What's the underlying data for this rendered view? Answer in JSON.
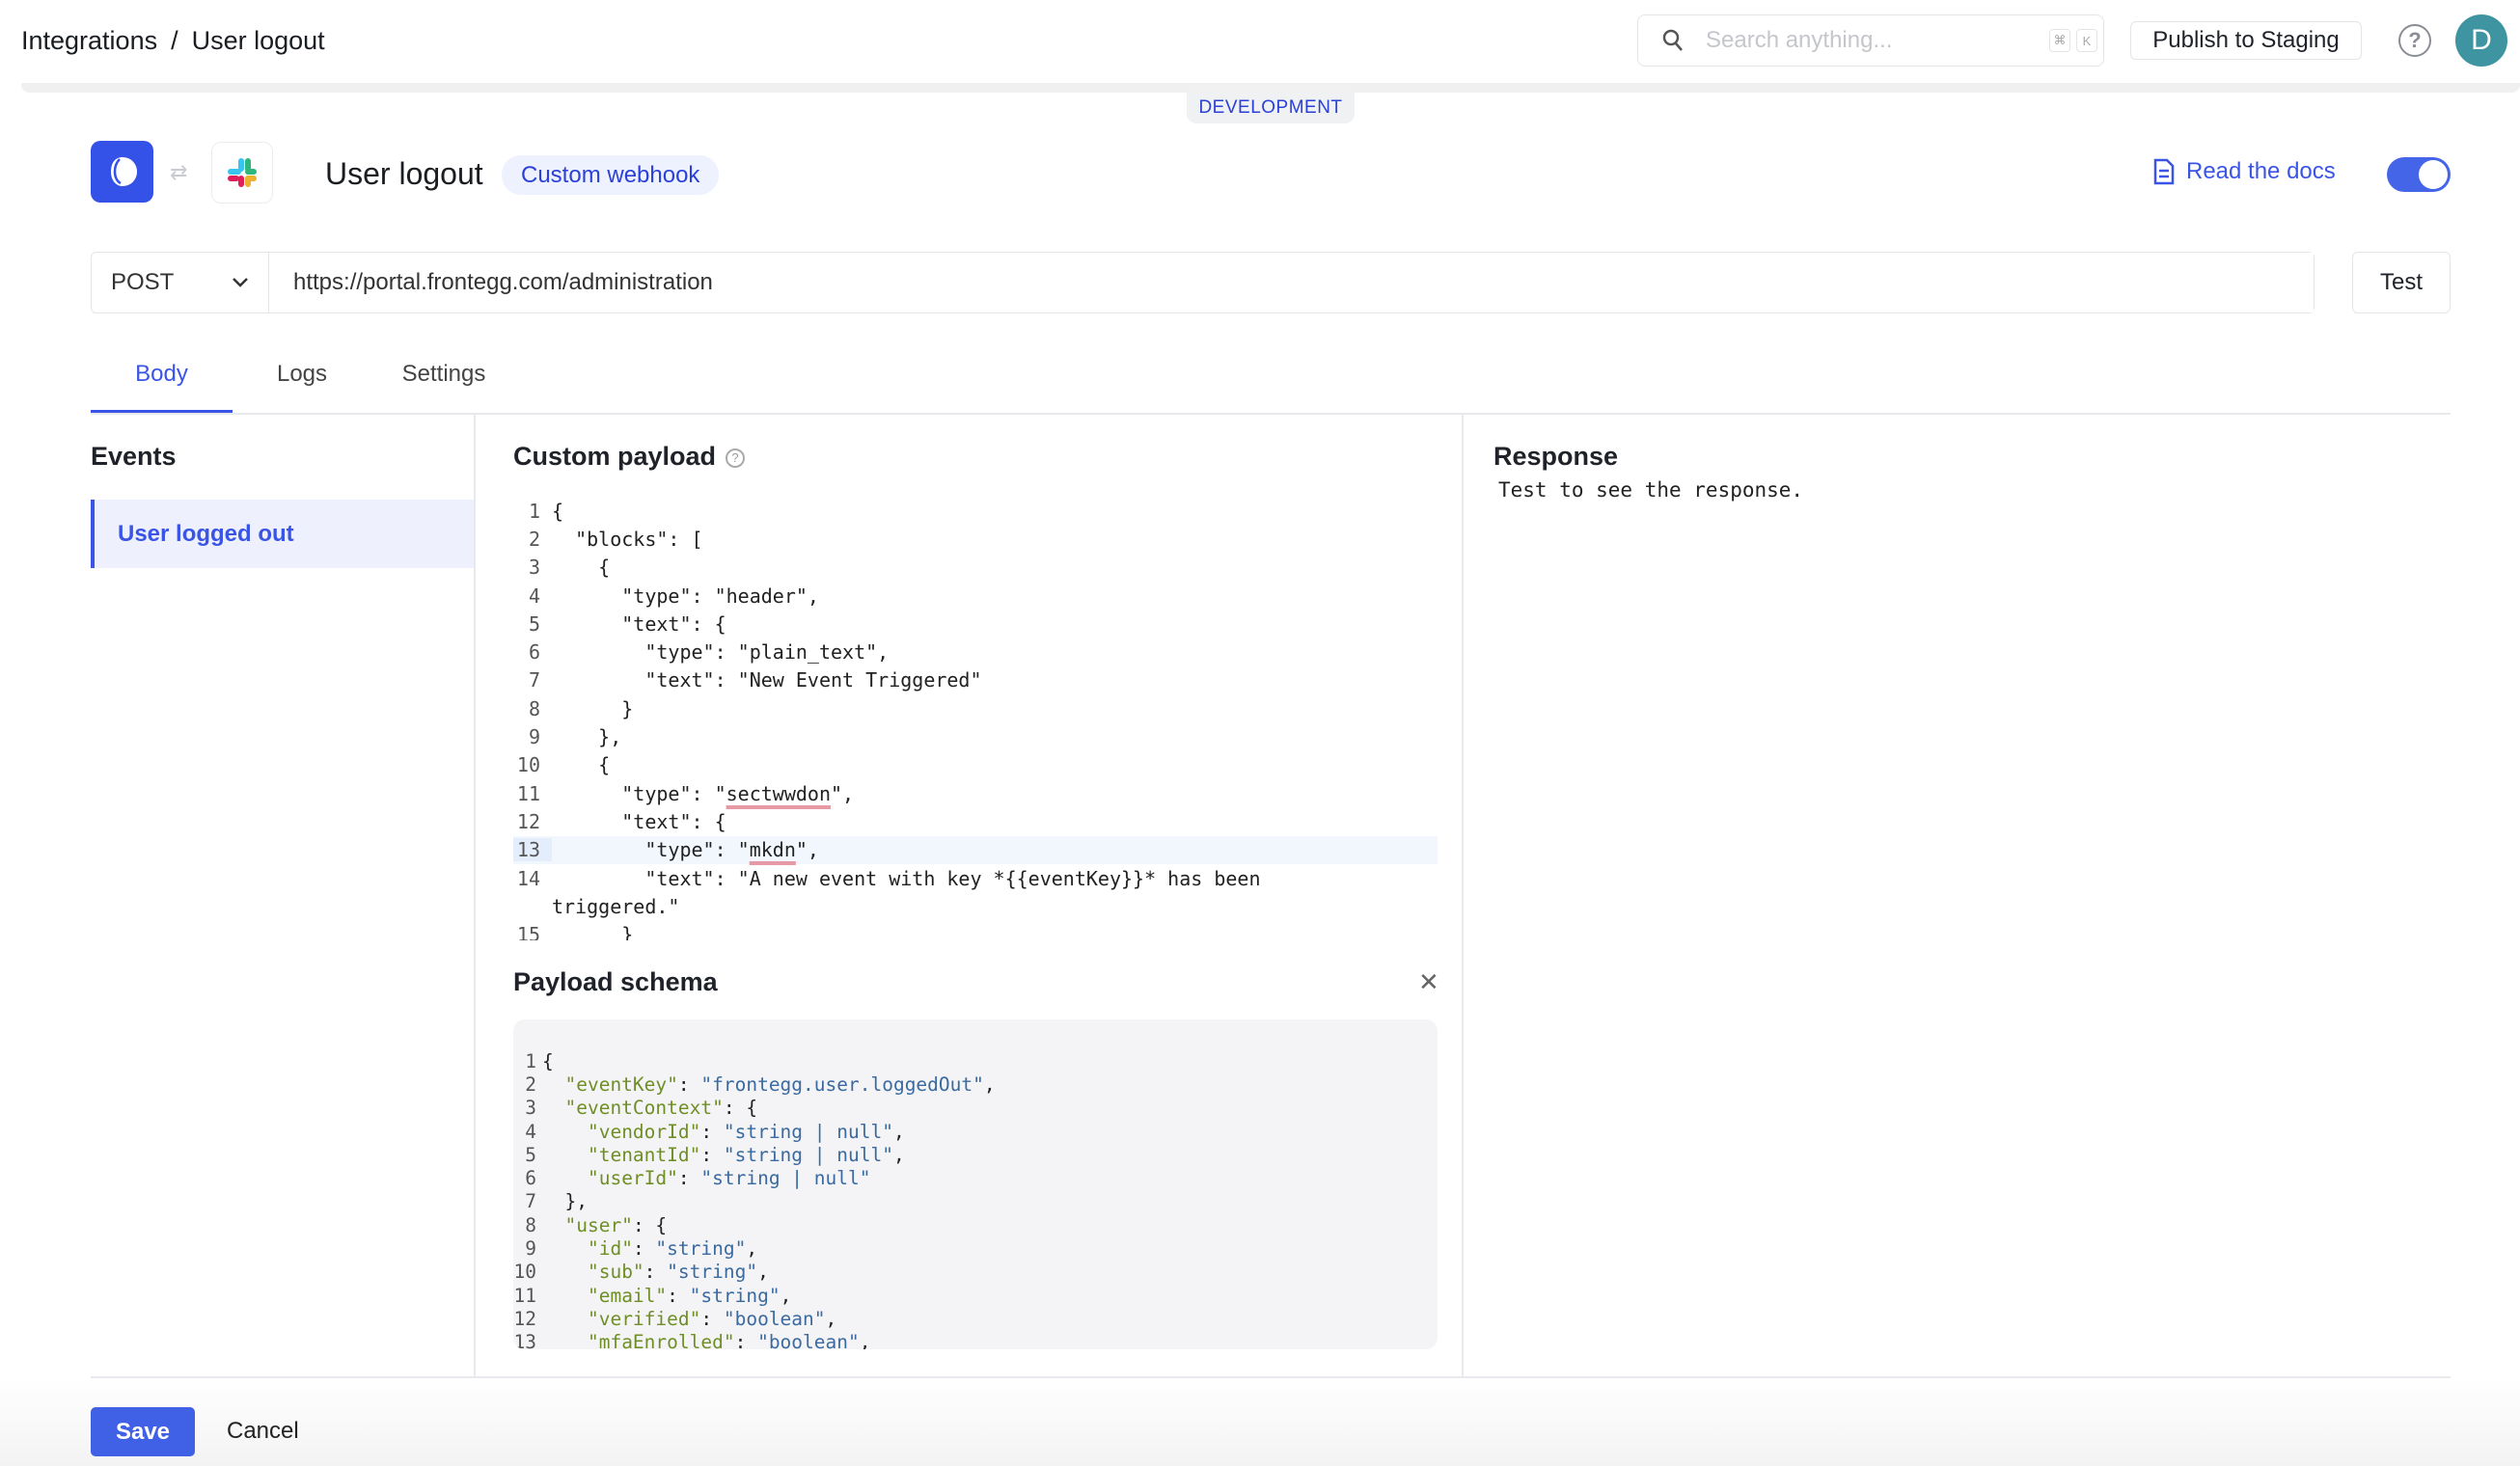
{
  "breadcrumb": {
    "root": "Integrations",
    "separator": "/",
    "current": "User logout"
  },
  "search": {
    "placeholder": "Search anything...",
    "shortcut_mod": "⌘",
    "shortcut_key": "K"
  },
  "header": {
    "publish_label": "Publish to Staging",
    "avatar_initial": "D",
    "help_icon": "question-circle-icon"
  },
  "environment_badge": "DEVELOPMENT",
  "integration": {
    "title": "User logout",
    "type_badge": "Custom webhook",
    "docs_label": "Read the docs",
    "enabled": true
  },
  "request": {
    "method": "POST",
    "url": "https://portal.frontegg.com/administration",
    "test_label": "Test"
  },
  "tabs": [
    {
      "label": "Body",
      "active": true
    },
    {
      "label": "Logs"
    },
    {
      "label": "Settings"
    }
  ],
  "events": {
    "heading": "Events",
    "items": [
      {
        "label": "User logged out",
        "selected": true
      }
    ]
  },
  "payload": {
    "heading": "Custom payload",
    "current_line": 13,
    "lines": [
      [
        [
          "{",
          ""
        ]
      ],
      [
        [
          "  \"blocks\": [",
          ""
        ]
      ],
      [
        [
          "    {",
          ""
        ]
      ],
      [
        [
          "      \"type\": \"header\",",
          ""
        ]
      ],
      [
        [
          "      \"text\": {",
          ""
        ]
      ],
      [
        [
          "        \"type\": \"plain_text\",",
          ""
        ]
      ],
      [
        [
          "        \"text\": \"New Event Triggered\"",
          ""
        ]
      ],
      [
        [
          "      }",
          ""
        ]
      ],
      [
        [
          "    },",
          ""
        ]
      ],
      [
        [
          "    {",
          ""
        ]
      ],
      [
        [
          "      \"type\": \"",
          ""
        ],
        [
          "sectwwdon",
          "err"
        ],
        [
          "\",",
          ""
        ]
      ],
      [
        [
          "      \"text\": {",
          ""
        ]
      ],
      [
        [
          "        \"type\": \"",
          ""
        ],
        [
          "mkdn",
          "err"
        ],
        [
          "\",",
          ""
        ]
      ],
      [
        [
          "        \"text\": \"A new event with key *{{eventKey}}* has been",
          ""
        ]
      ],
      [
        [
          "triggered.\"",
          ""
        ]
      ],
      [
        [
          "      }",
          ""
        ]
      ]
    ]
  },
  "schema": {
    "heading": "Payload schema",
    "lines": [
      [
        [
          "{",
          ""
        ]
      ],
      [
        [
          "  ",
          ""
        ],
        [
          "\"eventKey\"",
          "k"
        ],
        [
          ": ",
          ""
        ],
        [
          "\"frontegg.user.loggedOut\"",
          "s"
        ],
        [
          ",",
          ""
        ]
      ],
      [
        [
          "  ",
          ""
        ],
        [
          "\"eventContext\"",
          "k"
        ],
        [
          ": {",
          ""
        ]
      ],
      [
        [
          "    ",
          ""
        ],
        [
          "\"vendorId\"",
          "k"
        ],
        [
          ": ",
          ""
        ],
        [
          "\"string | null\"",
          "s"
        ],
        [
          ",",
          ""
        ]
      ],
      [
        [
          "    ",
          ""
        ],
        [
          "\"tenantId\"",
          "k"
        ],
        [
          ": ",
          ""
        ],
        [
          "\"string | null\"",
          "s"
        ],
        [
          ",",
          ""
        ]
      ],
      [
        [
          "    ",
          ""
        ],
        [
          "\"userId\"",
          "k"
        ],
        [
          ": ",
          ""
        ],
        [
          "\"string | null\"",
          "s"
        ]
      ],
      [
        [
          "  },",
          ""
        ]
      ],
      [
        [
          "  ",
          ""
        ],
        [
          "\"user\"",
          "k"
        ],
        [
          ": {",
          ""
        ]
      ],
      [
        [
          "    ",
          ""
        ],
        [
          "\"id\"",
          "k"
        ],
        [
          ": ",
          ""
        ],
        [
          "\"string\"",
          "s"
        ],
        [
          ",",
          ""
        ]
      ],
      [
        [
          "    ",
          ""
        ],
        [
          "\"sub\"",
          "k"
        ],
        [
          ": ",
          ""
        ],
        [
          "\"string\"",
          "s"
        ],
        [
          ",",
          ""
        ]
      ],
      [
        [
          "    ",
          ""
        ],
        [
          "\"email\"",
          "k"
        ],
        [
          ": ",
          ""
        ],
        [
          "\"string\"",
          "s"
        ],
        [
          ",",
          ""
        ]
      ],
      [
        [
          "    ",
          ""
        ],
        [
          "\"verified\"",
          "k"
        ],
        [
          ": ",
          ""
        ],
        [
          "\"boolean\"",
          "s"
        ],
        [
          ",",
          ""
        ]
      ],
      [
        [
          "    ",
          ""
        ],
        [
          "\"mfaEnrolled\"",
          "k"
        ],
        [
          ": ",
          ""
        ],
        [
          "\"boolean\"",
          "s"
        ],
        [
          ",",
          ""
        ]
      ]
    ]
  },
  "response": {
    "heading": "Response",
    "placeholder": "Test to see the response."
  },
  "footer": {
    "save_label": "Save",
    "cancel_label": "Cancel"
  },
  "colors": {
    "accent": "#3a55e6",
    "avatar": "#3f94a2",
    "key": "#6f8f26",
    "string": "#3a6aa0"
  }
}
